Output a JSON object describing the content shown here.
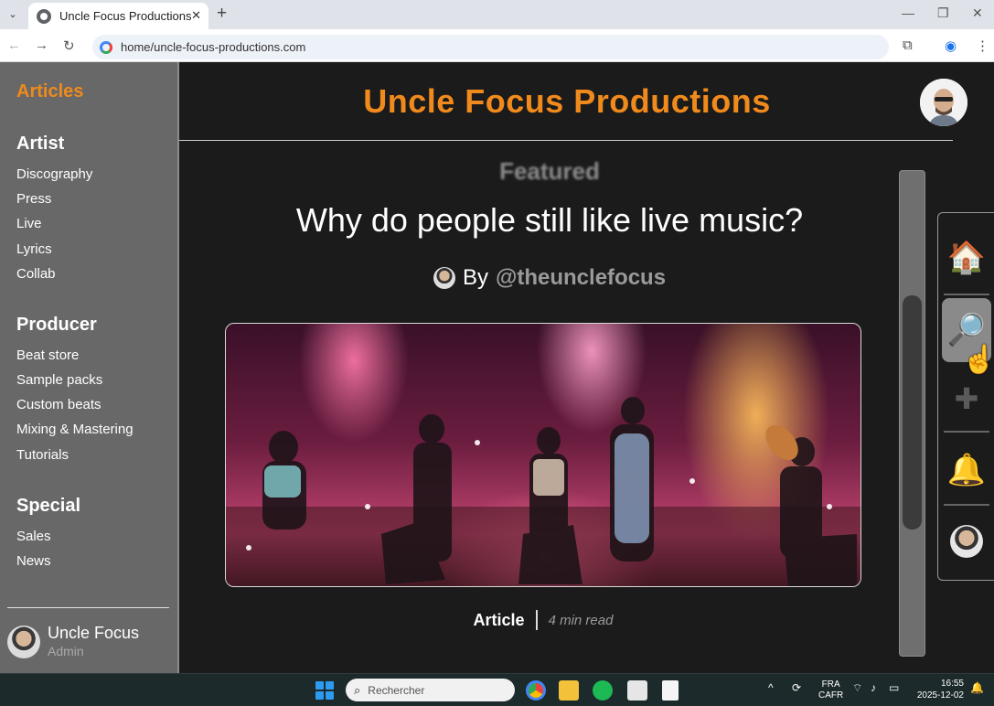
{
  "browser": {
    "tab_title": "Uncle Focus Productions",
    "tab_close": "✕",
    "new_tab": "+",
    "url": "home/uncle-focus-productions.com"
  },
  "sidebar": {
    "brand": "Articles",
    "sections": [
      {
        "title": "Artist",
        "items": [
          "Discography",
          "Press",
          "Live",
          "Lyrics",
          "Collab"
        ]
      },
      {
        "title": "Producer",
        "items": [
          "Beat store",
          "Sample packs",
          "Custom beats",
          "Mixing & Mastering",
          "Tutorials"
        ]
      },
      {
        "title": "Special",
        "items": [
          "Sales",
          "News"
        ]
      }
    ],
    "user": {
      "name": "Uncle Focus",
      "role": "Admin"
    }
  },
  "header": {
    "title": "Uncle Focus Productions"
  },
  "article": {
    "kicker": "Featured",
    "headline": "Why do people still like live music?",
    "by": "By",
    "handle": "@theunclefocus",
    "type": "Article",
    "read_time": "4 min read"
  },
  "right_nav": {
    "home_icon": "🏠",
    "search_icon": "🔎",
    "add_icon": "✚",
    "bell_icon": "🔔"
  },
  "taskbar": {
    "search_placeholder": "Rechercher",
    "lang_1": "FRA",
    "lang_2": "CAFR",
    "time": "16:55",
    "date": "2025-12-02"
  },
  "colors": {
    "accent": "#f08a1c",
    "sidebar": "#686868",
    "page": "#1b1b1b"
  }
}
